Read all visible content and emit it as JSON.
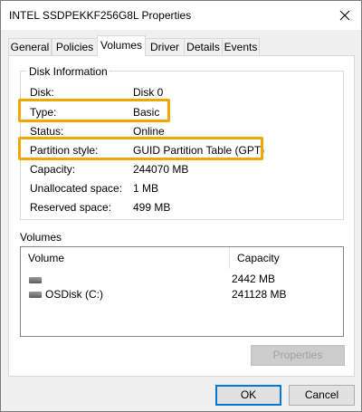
{
  "window": {
    "title": "INTEL SSDPEKKF256G8L Properties"
  },
  "tabs": [
    {
      "label": "General"
    },
    {
      "label": "Policies"
    },
    {
      "label": "Volumes"
    },
    {
      "label": "Driver"
    },
    {
      "label": "Details"
    },
    {
      "label": "Events"
    }
  ],
  "active_tab": "Volumes",
  "disk_info": {
    "heading": "Disk Information",
    "rows": [
      {
        "label": "Disk:",
        "value": "Disk 0"
      },
      {
        "label": "Type:",
        "value": "Basic"
      },
      {
        "label": "Status:",
        "value": "Online"
      },
      {
        "label": "Partition style:",
        "value": "GUID Partition Table (GPT)"
      },
      {
        "label": "Capacity:",
        "value": "244070 MB"
      },
      {
        "label": "Unallocated space:",
        "value": "1 MB"
      },
      {
        "label": "Reserved space:",
        "value": "499 MB"
      }
    ]
  },
  "volumes": {
    "heading": "Volumes",
    "columns": [
      "Volume",
      "Capacity"
    ],
    "rows": [
      {
        "volume": "",
        "capacity": "2442 MB",
        "icon": "drive-icon"
      },
      {
        "volume": "OSDisk (C:)",
        "capacity": "241128 MB",
        "icon": "drive-icon"
      }
    ],
    "properties_button": "Properties"
  },
  "footer": {
    "ok": "OK",
    "cancel": "Cancel"
  },
  "colors": {
    "highlight": "#f0a800",
    "default_button_border": "#0078d7"
  }
}
